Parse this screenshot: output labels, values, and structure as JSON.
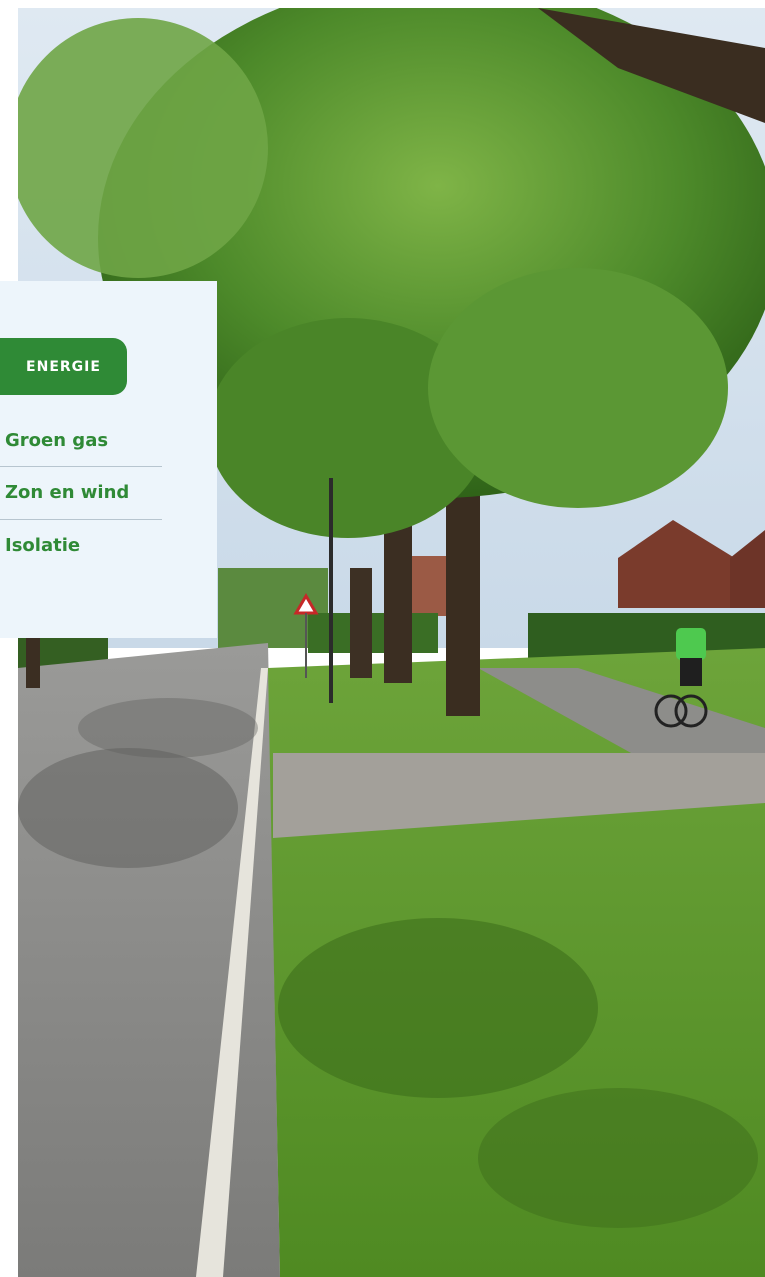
{
  "menu": {
    "category_label": "ENERGIE",
    "items": [
      {
        "label": "Groen gas"
      },
      {
        "label": "Zon en wind"
      },
      {
        "label": "Isolatie"
      }
    ]
  },
  "colors": {
    "accent": "#2f8a36",
    "panel_background": "#edf5fb",
    "divider": "#b7c5cf"
  },
  "photo": {
    "subject": "street-scene-photo"
  }
}
